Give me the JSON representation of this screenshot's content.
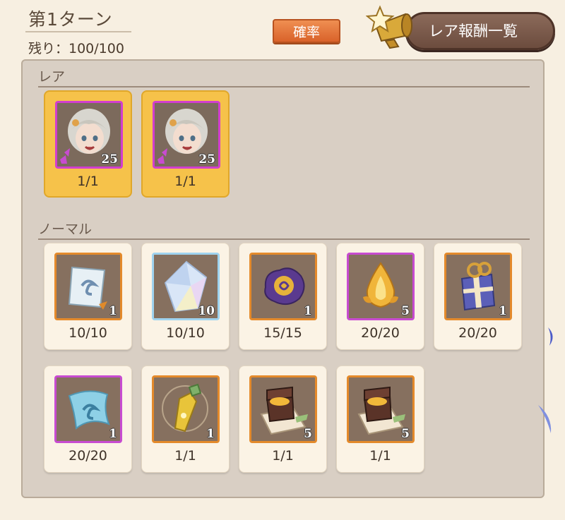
{
  "header": {
    "turn_title": "第1ターン",
    "remaining": "残り：100/100",
    "prob_label": "確率",
    "rare_list_label": "レア報酬一覧"
  },
  "sections": {
    "rare_label": "レア",
    "normal_label": "ノーマル"
  },
  "rare_items": [
    {
      "icon": "character-portrait-icon",
      "qty": "25",
      "count": "1/1"
    },
    {
      "icon": "character-portrait-icon",
      "qty": "25",
      "count": "1/1"
    }
  ],
  "normal_items": [
    {
      "icon": "scroll-icon",
      "qty": "1",
      "count": "10/10"
    },
    {
      "icon": "crystal-icon",
      "qty": "10",
      "count": "10/10"
    },
    {
      "icon": "purple-slime-icon",
      "qty": "1",
      "count": "15/15"
    },
    {
      "icon": "golden-flame-icon",
      "qty": "5",
      "count": "20/20"
    },
    {
      "icon": "gift-box-icon",
      "qty": "1",
      "count": "20/20"
    },
    {
      "icon": "blue-cloth-icon",
      "qty": "1",
      "count": "20/20"
    },
    {
      "icon": "potion-bottle-icon",
      "qty": "1",
      "count": "1/1"
    },
    {
      "icon": "treasure-chest-icon",
      "qty": "5",
      "count": "1/1"
    },
    {
      "icon": "treasure-chest-icon",
      "qty": "5",
      "count": "1/1"
    }
  ],
  "colors": {
    "rare_card": "#f6c24a",
    "frame_orange": "#e48a2b",
    "frame_purple": "#c84bd1",
    "button_orange": "#e0743a",
    "button_brown": "#6c4c3e"
  }
}
